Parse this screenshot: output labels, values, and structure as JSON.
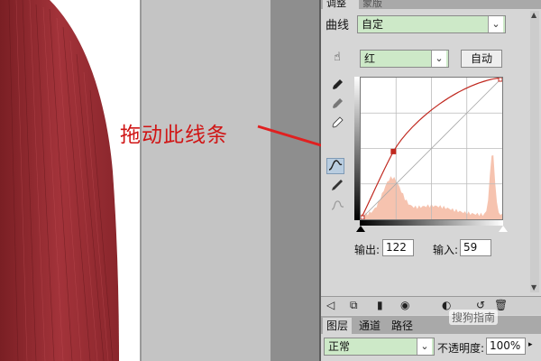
{
  "annotation": {
    "text": "拖动此线条"
  },
  "curves_panel": {
    "tab_active": "调整",
    "tab_inactive": "蒙版",
    "curve_label": "曲线",
    "preset_value": "自定",
    "channel_value": "红",
    "auto_button": "自动",
    "output_label": "输出:",
    "output_value": "122",
    "input_label": "输入:",
    "input_value": "59",
    "tools": [
      "hand-target-icon",
      "eyedropper-black-icon",
      "eyedropper-gray-icon",
      "eyedropper-white-icon",
      "curve-tool-icon",
      "pencil-icon",
      "smooth-icon"
    ],
    "curve_points": [
      {
        "input": 0,
        "output": 0
      },
      {
        "input": 59,
        "output": 122
      },
      {
        "input": 255,
        "output": 255
      }
    ],
    "curve_color": "#c0281f",
    "histogram_color": "#f4b9a1"
  },
  "bottom_toolbar": {
    "icons": [
      "back-arrow-icon",
      "clip-icon",
      "visibility-toggle-icon",
      "eye-icon",
      "view-previous-icon",
      "reset-icon",
      "trash-icon"
    ]
  },
  "layers_panel": {
    "tabs": [
      "图层",
      "通道",
      "路径"
    ],
    "blend_mode": "正常",
    "opacity_label": "不透明度:",
    "opacity_value": "100%"
  },
  "watermark": {
    "text": "搜狗指南"
  }
}
